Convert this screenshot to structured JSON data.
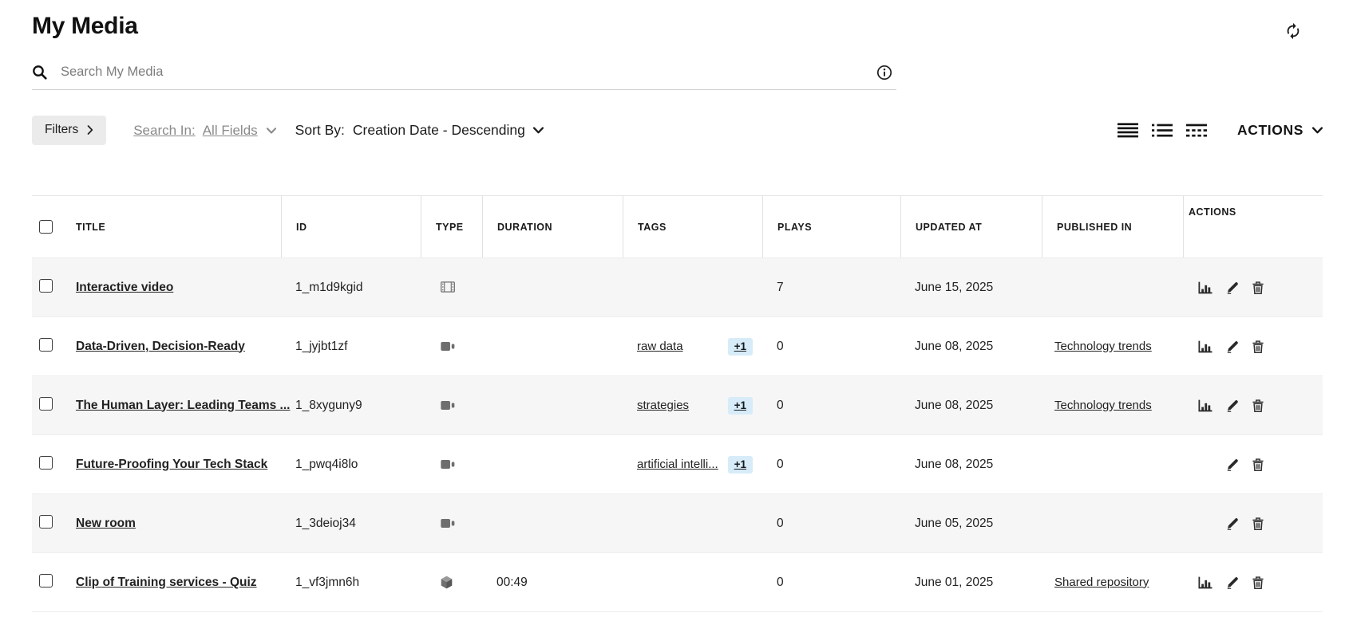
{
  "header": {
    "title": "My Media"
  },
  "search": {
    "placeholder": "Search My Media",
    "value": ""
  },
  "toolbar": {
    "filters_label": "Filters",
    "search_in_label": "Search In:",
    "search_in_value": "All Fields",
    "sort_by_label": "Sort By:",
    "sort_by_value": "Creation Date - Descending",
    "actions_label": "ACTIONS"
  },
  "icons": {
    "refresh": "circular-arrows",
    "search": "magnifier",
    "info": "circle-i",
    "filters_chevron": "chevron-right",
    "dropdown_chevron": "chevron-down",
    "view_mode_1": "four-horizontal-lines",
    "view_mode_2": "bulleted-list-lines",
    "view_mode_3": "solid-and-dashed-lines",
    "analytics": "bar-chart",
    "edit": "pencil",
    "delete": "trash",
    "type_interactive_video": "film-strip",
    "type_video": "video-camera",
    "type_quiz": "cube"
  },
  "colors": {
    "tag_badge_bg": "#d7ecf8",
    "row_alt_bg": "#f6f6f6",
    "filters_button_bg": "#ebebeb",
    "muted_text": "#8a8a8a"
  },
  "table": {
    "columns": [
      "TITLE",
      "ID",
      "TYPE",
      "DURATION",
      "TAGS",
      "PLAYS",
      "UPDATED AT",
      "PUBLISHED IN",
      "ACTIONS"
    ],
    "rows": [
      {
        "title": "Interactive video",
        "id": "1_m1d9kgid",
        "type": "interactive-video",
        "duration": "",
        "tags": "",
        "tag_more": "",
        "plays": "7",
        "updated_at": "June 15, 2025",
        "published_in": "",
        "actions": [
          "analytics",
          "edit",
          "delete"
        ]
      },
      {
        "title": "Data-Driven, Decision-Ready",
        "id": "1_jyjbt1zf",
        "type": "video",
        "duration": "",
        "tags": "raw data",
        "tag_more": "+1",
        "plays": "0",
        "updated_at": "June 08, 2025",
        "published_in": "Technology trends",
        "actions": [
          "analytics",
          "edit",
          "delete"
        ]
      },
      {
        "title": "The Human Layer: Leading Teams ...",
        "id": "1_8xyguny9",
        "type": "video",
        "duration": "",
        "tags": "strategies",
        "tag_more": "+1",
        "plays": "0",
        "updated_at": "June 08, 2025",
        "published_in": "Technology trends",
        "actions": [
          "analytics",
          "edit",
          "delete"
        ]
      },
      {
        "title": "Future-Proofing Your Tech Stack",
        "id": "1_pwq4i8lo",
        "type": "video",
        "duration": "",
        "tags": "artificial intelli...",
        "tag_more": "+1",
        "plays": "0",
        "updated_at": "June 08, 2025",
        "published_in": "",
        "actions": [
          "edit",
          "delete"
        ]
      },
      {
        "title": "New room",
        "id": "1_3deioj34",
        "type": "video",
        "duration": "",
        "tags": "",
        "tag_more": "",
        "plays": "0",
        "updated_at": "June 05, 2025",
        "published_in": "",
        "actions": [
          "edit",
          "delete"
        ]
      },
      {
        "title": "Clip of Training services - Quiz",
        "id": "1_vf3jmn6h",
        "type": "quiz",
        "duration": "00:49",
        "tags": "",
        "tag_more": "",
        "plays": "0",
        "updated_at": "June 01, 2025",
        "published_in": "Shared repository",
        "actions": [
          "analytics",
          "edit",
          "delete"
        ]
      }
    ]
  }
}
